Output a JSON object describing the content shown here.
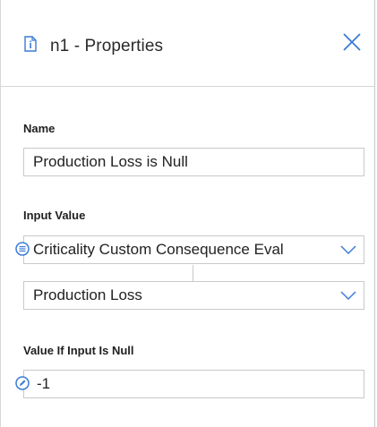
{
  "header": {
    "title": "n1 - Properties",
    "doc_icon": "document-info-icon",
    "close_icon": "close-icon"
  },
  "name_section": {
    "label": "Name",
    "value": "Production Loss is Null"
  },
  "input_value_section": {
    "label": "Input Value",
    "source_value": "Criticality Custom Consequence Eval",
    "field_value": "Production Loss",
    "source_icon": "list-icon",
    "chevron_icon": "chevron-down-icon"
  },
  "null_value_section": {
    "label": "Value If Input Is Null",
    "value": "-1",
    "edit_icon": "pencil-icon"
  },
  "colors": {
    "accent": "#3a7bd5",
    "border": "#c9c9c9"
  }
}
